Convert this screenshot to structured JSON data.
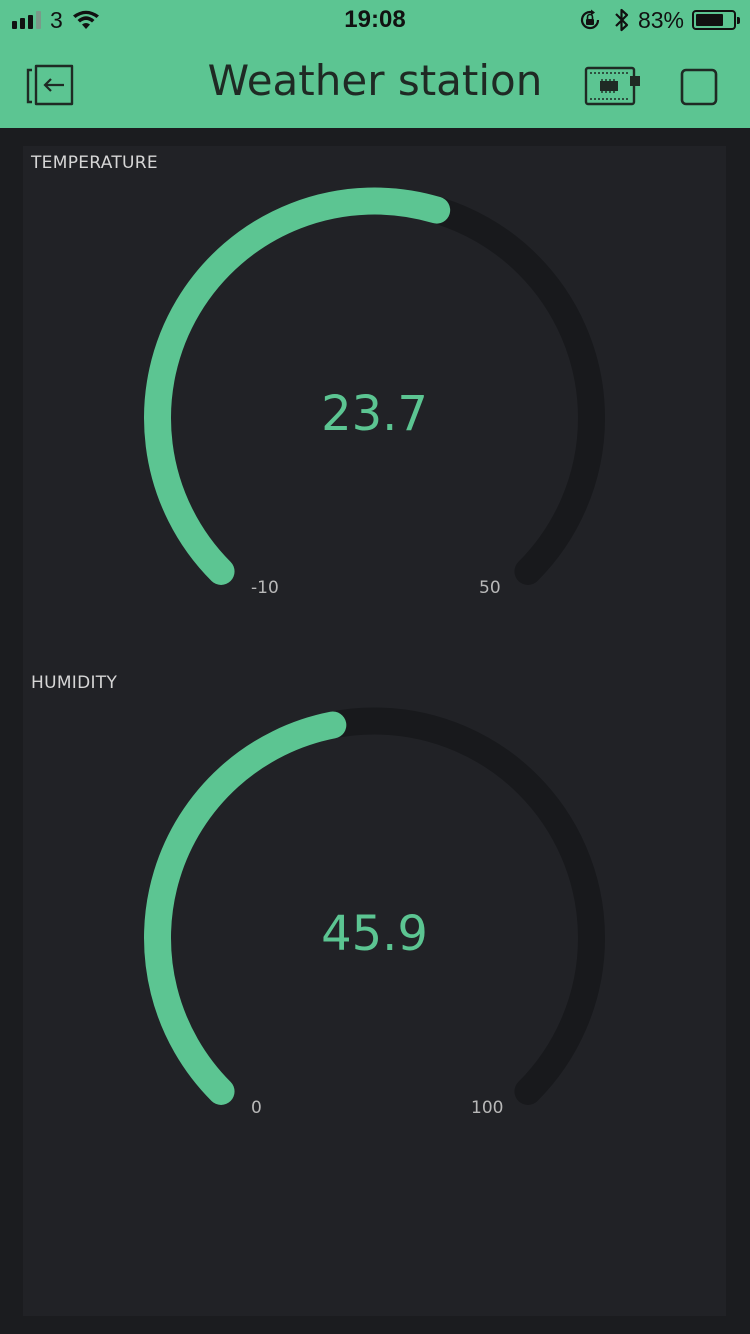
{
  "status_bar": {
    "carrier": "3",
    "time": "19:08",
    "battery_percent": "83%",
    "battery_level": 0.83,
    "signal_bars_filled": 3,
    "icons": [
      "signal-icon",
      "wifi-icon",
      "rotation-lock-icon",
      "bluetooth-icon",
      "battery-icon"
    ]
  },
  "header": {
    "title": "Weather station",
    "left_icon": "exit-project-icon",
    "right_icons": [
      "device-board-icon",
      "stop-square-icon"
    ]
  },
  "widgets": [
    {
      "label": "TEMPERATURE",
      "value": "23.7",
      "value_num": 23.7,
      "min": "-10",
      "min_num": -10,
      "max": "50",
      "max_num": 50
    },
    {
      "label": "HUMIDITY",
      "value": "45.9",
      "value_num": 45.9,
      "min": "0",
      "min_num": 0,
      "max": "100",
      "max_num": 100
    }
  ],
  "colors": {
    "accent": "#5cc592",
    "background": "#1b1c1f",
    "panel": "#212226",
    "gauge_track": "#18191c"
  }
}
